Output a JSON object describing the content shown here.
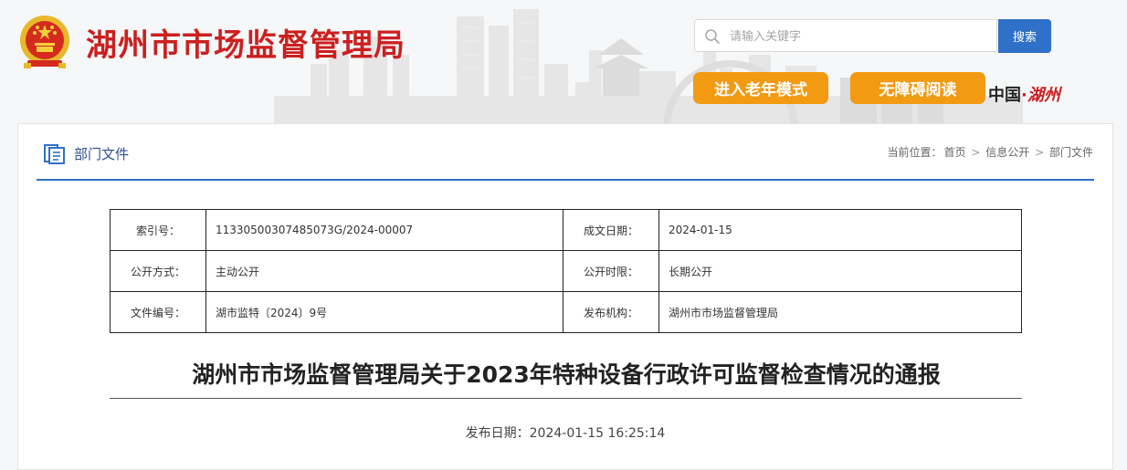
{
  "header": {
    "site_title": "湖州市市场监督管理局",
    "search": {
      "placeholder": "请输入关键字",
      "button_label": "搜索"
    },
    "elder_mode_label": "进入老年模式",
    "accessible_label": "无障碍阅读",
    "brand": {
      "part1": "中国",
      "dot": "·",
      "part2": "湖州"
    }
  },
  "section": {
    "title": "部门文件",
    "breadcrumb": {
      "prefix": "当前位置：",
      "items": [
        "首页",
        "信息公开",
        "部门文件"
      ],
      "separator": ">"
    }
  },
  "meta_table": {
    "rows": [
      {
        "label1": "索引号：",
        "value1": "11330500307485073G/2024-00007",
        "label2": "成文日期：",
        "value2": "2024-01-15"
      },
      {
        "label1": "公开方式：",
        "value1": "主动公开",
        "label2": "公开时限：",
        "value2": "长期公开"
      },
      {
        "label1": "文件编号：",
        "value1": "湖市监特〔2024〕9号",
        "label2": "发布机构：",
        "value2": "湖州市市场监督管理局"
      }
    ]
  },
  "document": {
    "title": "湖州市市场监督管理局关于2023年特种设备行政许可监督检查情况的通报",
    "publish_label": "发布日期：",
    "publish_date": "2024-01-15 16:25:14"
  },
  "colors": {
    "brand_red": "#cc1f1f",
    "accent_blue": "#2f71c8",
    "button_orange": "#f29a12"
  },
  "icons": [
    "emblem-icon",
    "search-icon",
    "document-section-icon"
  ]
}
